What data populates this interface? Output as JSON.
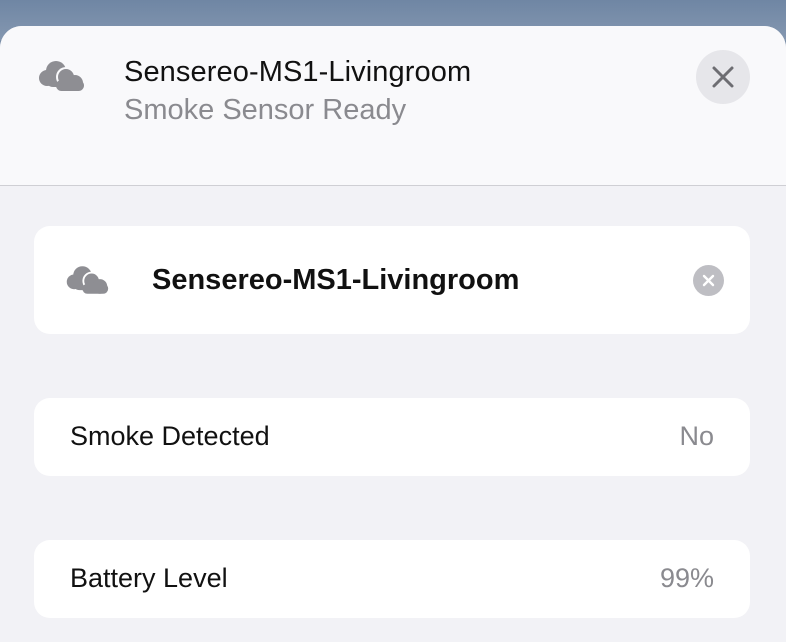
{
  "header": {
    "title": "Sensereo-MS1-Livingroom",
    "subtitle": "Smoke Sensor Ready",
    "icon": "cloud-icon"
  },
  "name_field": {
    "value": "Sensereo-MS1-Livingroom",
    "icon": "cloud-icon"
  },
  "rows": [
    {
      "label": "Smoke Detected",
      "value": "No"
    },
    {
      "label": "Battery Level",
      "value": "99%"
    }
  ],
  "colors": {
    "sheet_background": "#f2f2f6",
    "header_background": "#f9f9fb",
    "card_background": "#ffffff",
    "primary_text": "#111111",
    "secondary_text": "#8a8a8f",
    "icon_gray": "#8e8e93"
  }
}
